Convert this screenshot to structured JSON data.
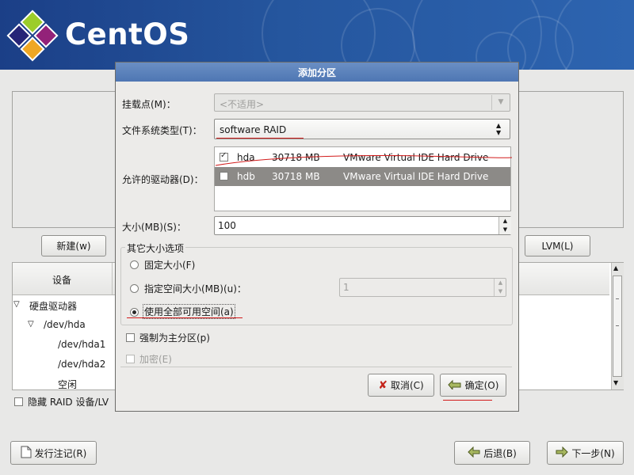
{
  "header": {
    "brand": "CentOS"
  },
  "main": {
    "new_button": "新建(w)",
    "lvm_button": "LVM(L)",
    "table_header_device": "设备",
    "tree": [
      "硬盘驱动器",
      "/dev/hda",
      "/dev/hda1",
      "/dev/hda2",
      "空闲"
    ],
    "hide_raid_label": "隐藏 RAID 设备/LV"
  },
  "footer": {
    "release_notes": "发行注记(R)",
    "back": "后退(B)",
    "next": "下一步(N)"
  },
  "dialog": {
    "title": "添加分区",
    "mount_point_label": "挂载点(M)：",
    "mount_point_value": "<不适用>",
    "fs_type_label": "文件系统类型(T)：",
    "fs_type_value": "software RAID",
    "drives_label": "允许的驱动器(D)：",
    "drives": [
      {
        "name": "hda",
        "size": "30718 MB",
        "model": "VMware Virtual IDE Hard Drive",
        "checked": true
      },
      {
        "name": "hdb",
        "size": "30718 MB",
        "model": "VMware Virtual IDE Hard Drive",
        "checked": false
      }
    ],
    "size_label": "大小(MB)(S)：",
    "size_value": "100",
    "other_size_group": "其它大小选项",
    "fixed_size": "固定大小(F)",
    "fill_to_size": "指定空间大小(MB)(u)：",
    "fill_to_size_value": "1",
    "fill_all": "使用全部可用空间(a)",
    "force_primary": "强制为主分区(p)",
    "encrypt": "加密(E)",
    "cancel": "取消(C)",
    "ok": "确定(O)"
  },
  "colors": {
    "header_blue": "#25569e",
    "dialog_title": "#5a80bb",
    "selected_row": "#8c8a87",
    "annotation_red": "#d21b1b"
  }
}
